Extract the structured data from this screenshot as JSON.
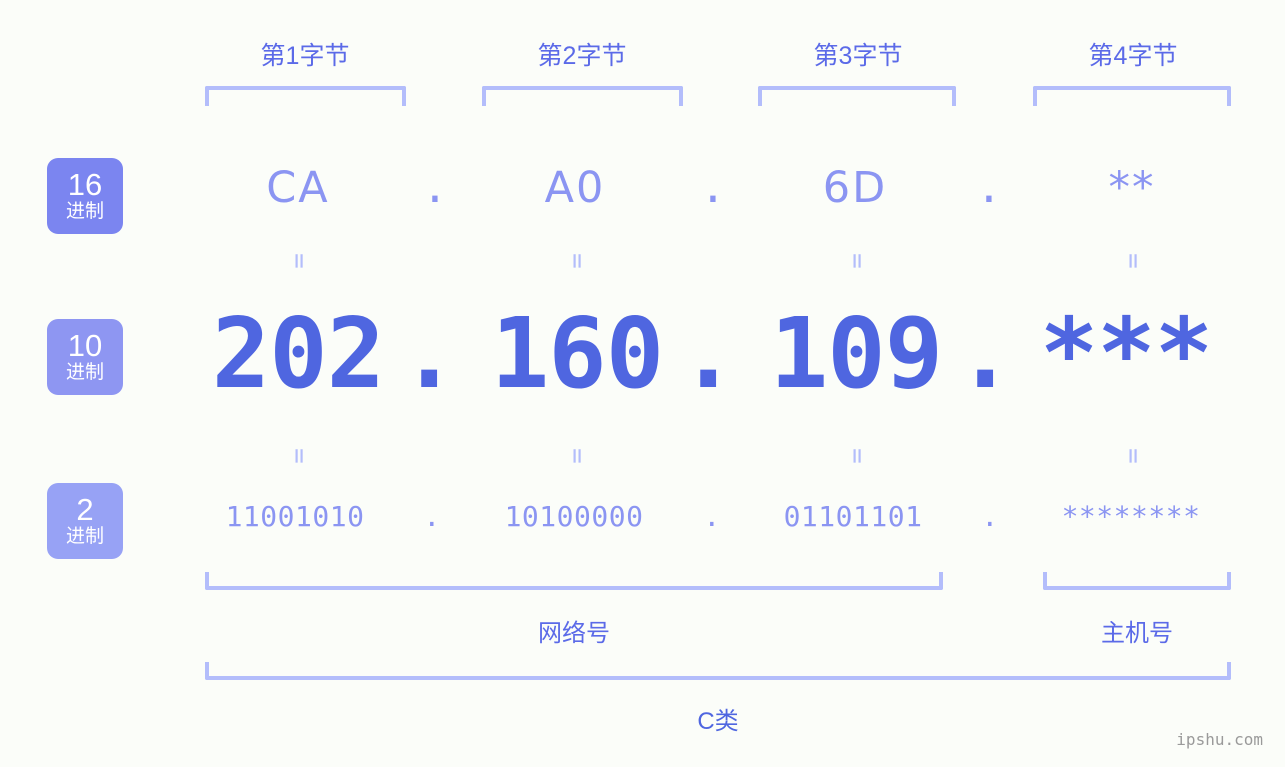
{
  "background_color": "#fbfdf9",
  "accent_color": "#5b6ae8",
  "accent_light": "#8b95f2",
  "bracket_color": "#b3bdfb",
  "header": {
    "bytes": [
      {
        "label": "第1字节"
      },
      {
        "label": "第2字节"
      },
      {
        "label": "第3字节"
      },
      {
        "label": "第4字节"
      }
    ]
  },
  "legend": [
    {
      "num": "16",
      "system": "进制",
      "color": "#7b85f0"
    },
    {
      "num": "10",
      "system": "进制",
      "color": "#8e96f2"
    },
    {
      "num": "2",
      "system": "进制",
      "color": "#97a2f5"
    }
  ],
  "rows": {
    "hex": {
      "values": [
        "CA",
        "A0",
        "6D",
        "**"
      ],
      "separator": "."
    },
    "decimal": {
      "values": [
        "202",
        "160",
        "109",
        "***"
      ],
      "separator": "."
    },
    "binary": {
      "values": [
        "11001010",
        "10100000",
        "01101101",
        "********"
      ],
      "separator": "."
    }
  },
  "equals_symbol": "=",
  "footer": {
    "network_label": "网络号",
    "host_label": "主机号",
    "class_label": "C类"
  },
  "watermark": "ipshu.com"
}
